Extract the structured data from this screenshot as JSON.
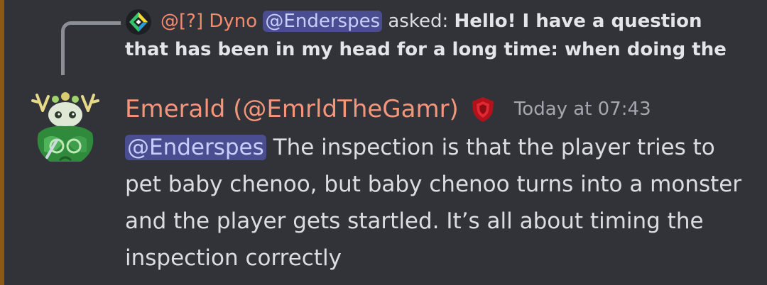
{
  "reply": {
    "author": "@[?] Dyno",
    "mention": "@Enderspes",
    "verb": "asked:",
    "question": "Hello! I have a question that has been in my head for a long time: when doing the",
    "icon": "dyno-bot-icon"
  },
  "message": {
    "username": "Emerald (@EmrldTheGamr)",
    "role_icon": "red-shield-icon",
    "timestamp": "Today at 07:43",
    "mention": "@Enderspes",
    "text": " The inspection is that the player tries to pet baby chenoo, but baby chenoo turns into a monster and the player gets startled. It’s all about timing the inspection correctly"
  },
  "colors": {
    "background": "#323339",
    "username": "#f5967a",
    "reply_author": "#f28b6e",
    "mention_bg": "#4a4d8f",
    "mention_text": "#c9cdfb",
    "timestamp": "#a4a7ad"
  }
}
